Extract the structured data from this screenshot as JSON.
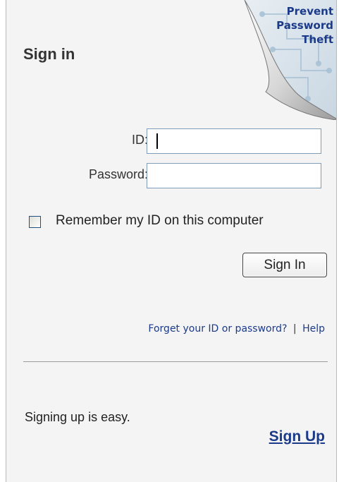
{
  "promo": {
    "line1": "Prevent",
    "line2": "Password",
    "line3": "Theft"
  },
  "title": "Sign in",
  "form": {
    "id_label": "ID:",
    "id_value": "",
    "password_label": "Password:",
    "password_value": "",
    "remember_label": "Remember my ID on this computer",
    "remember_checked": false,
    "signin_label": "Sign In"
  },
  "help": {
    "forgot_label": "Forget your ID or password?",
    "separator": "|",
    "help_label": "Help"
  },
  "signup": {
    "text": "Signing up is easy.",
    "link_label": "Sign Up"
  },
  "colors": {
    "link": "#1b3a8a",
    "panel_bg": "#f4f4f4"
  }
}
